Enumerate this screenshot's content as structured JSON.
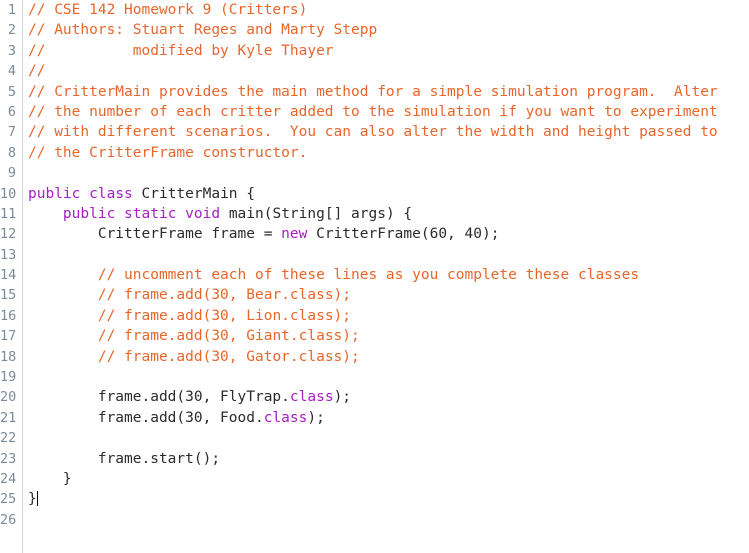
{
  "editor": {
    "name": "java-source-editor",
    "background_color": "#ffffff",
    "gutter_color": "#7d8b99",
    "separator_color": "#d2d2d2",
    "comment_color": "#e8662a",
    "keyword_color": "#a61ec4",
    "text_color": "#2b2b2b",
    "total_lines": 26,
    "cursor": {
      "line": 25,
      "column": 2,
      "visible": true
    }
  },
  "lines": [
    {
      "number": "1",
      "text": "// CSE 142 Homework 9 (Critters)",
      "tokens": [
        {
          "t": "// CSE 142 Homework 9 (Critters)",
          "k": "cmt"
        }
      ]
    },
    {
      "number": "2",
      "text": "// Authors: Stuart Reges and Marty Stepp",
      "tokens": [
        {
          "t": "// Authors: Stuart Reges and Marty Stepp",
          "k": "cmt"
        }
      ]
    },
    {
      "number": "3",
      "text": "//          modified by Kyle Thayer",
      "tokens": [
        {
          "t": "//          modified by Kyle Thayer",
          "k": "cmt"
        }
      ]
    },
    {
      "number": "4",
      "text": "//",
      "tokens": [
        {
          "t": "//",
          "k": "cmt"
        }
      ]
    },
    {
      "number": "5",
      "text": "// CritterMain provides the main method for a simple simulation program.  Alter",
      "tokens": [
        {
          "t": "// CritterMain provides the main method for a simple simulation program.  Alter",
          "k": "cmt"
        }
      ]
    },
    {
      "number": "6",
      "text": "// the number of each critter added to the simulation if you want to experiment",
      "tokens": [
        {
          "t": "// the number of each critter added to the simulation if you want to experiment",
          "k": "cmt"
        }
      ]
    },
    {
      "number": "7",
      "text": "// with different scenarios.  You can also alter the width and height passed to",
      "tokens": [
        {
          "t": "// with different scenarios.  You can also alter the width and height passed to",
          "k": "cmt"
        }
      ]
    },
    {
      "number": "8",
      "text": "// the CritterFrame constructor.",
      "tokens": [
        {
          "t": "// the CritterFrame constructor.",
          "k": "cmt"
        }
      ]
    },
    {
      "number": "9",
      "text": "",
      "tokens": []
    },
    {
      "number": "10",
      "text": "public class CritterMain {",
      "tokens": [
        {
          "t": "public",
          "k": "kw"
        },
        {
          "t": " ",
          "k": "txt"
        },
        {
          "t": "class",
          "k": "kw"
        },
        {
          "t": " CritterMain {",
          "k": "txt"
        }
      ]
    },
    {
      "number": "11",
      "text": "    public static void main(String[] args) {",
      "tokens": [
        {
          "t": "    ",
          "k": "txt"
        },
        {
          "t": "public",
          "k": "kw"
        },
        {
          "t": " ",
          "k": "txt"
        },
        {
          "t": "static",
          "k": "kw"
        },
        {
          "t": " ",
          "k": "txt"
        },
        {
          "t": "void",
          "k": "kw"
        },
        {
          "t": " main(String[] args) {",
          "k": "txt"
        }
      ]
    },
    {
      "number": "12",
      "text": "        CritterFrame frame = new CritterFrame(60, 40);",
      "tokens": [
        {
          "t": "        CritterFrame frame = ",
          "k": "txt"
        },
        {
          "t": "new",
          "k": "kw"
        },
        {
          "t": " CritterFrame(60, 40);",
          "k": "txt"
        }
      ]
    },
    {
      "number": "13",
      "text": "",
      "tokens": []
    },
    {
      "number": "14",
      "text": "        // uncomment each of these lines as you complete these classes",
      "tokens": [
        {
          "t": "        ",
          "k": "txt"
        },
        {
          "t": "// uncomment each of these lines as you complete these classes",
          "k": "cmt"
        }
      ]
    },
    {
      "number": "15",
      "text": "        // frame.add(30, Bear.class);",
      "tokens": [
        {
          "t": "        ",
          "k": "txt"
        },
        {
          "t": "// frame.add(30, Bear.class);",
          "k": "cmt"
        }
      ]
    },
    {
      "number": "16",
      "text": "        // frame.add(30, Lion.class);",
      "tokens": [
        {
          "t": "        ",
          "k": "txt"
        },
        {
          "t": "// frame.add(30, Lion.class);",
          "k": "cmt"
        }
      ]
    },
    {
      "number": "17",
      "text": "        // frame.add(30, Giant.class);",
      "tokens": [
        {
          "t": "        ",
          "k": "txt"
        },
        {
          "t": "// frame.add(30, Giant.class);",
          "k": "cmt"
        }
      ]
    },
    {
      "number": "18",
      "text": "        // frame.add(30, Gator.class);",
      "tokens": [
        {
          "t": "        ",
          "k": "txt"
        },
        {
          "t": "// frame.add(30, Gator.class);",
          "k": "cmt"
        }
      ]
    },
    {
      "number": "19",
      "text": "",
      "tokens": []
    },
    {
      "number": "20",
      "text": "        frame.add(30, FlyTrap.class);",
      "tokens": [
        {
          "t": "        frame.add(30, FlyTrap.",
          "k": "txt"
        },
        {
          "t": "class",
          "k": "kw"
        },
        {
          "t": ");",
          "k": "txt"
        }
      ]
    },
    {
      "number": "21",
      "text": "        frame.add(30, Food.class);",
      "tokens": [
        {
          "t": "        frame.add(30, Food.",
          "k": "txt"
        },
        {
          "t": "class",
          "k": "kw"
        },
        {
          "t": ");",
          "k": "txt"
        }
      ]
    },
    {
      "number": "22",
      "text": "",
      "tokens": []
    },
    {
      "number": "23",
      "text": "        frame.start();",
      "tokens": [
        {
          "t": "        frame.start();",
          "k": "txt"
        }
      ]
    },
    {
      "number": "24",
      "text": "    }",
      "tokens": [
        {
          "t": "    }",
          "k": "txt"
        }
      ]
    },
    {
      "number": "25",
      "text": "}",
      "tokens": [
        {
          "t": "}",
          "k": "txt"
        }
      ],
      "caret_after": true
    },
    {
      "number": "26",
      "text": "",
      "tokens": []
    }
  ]
}
